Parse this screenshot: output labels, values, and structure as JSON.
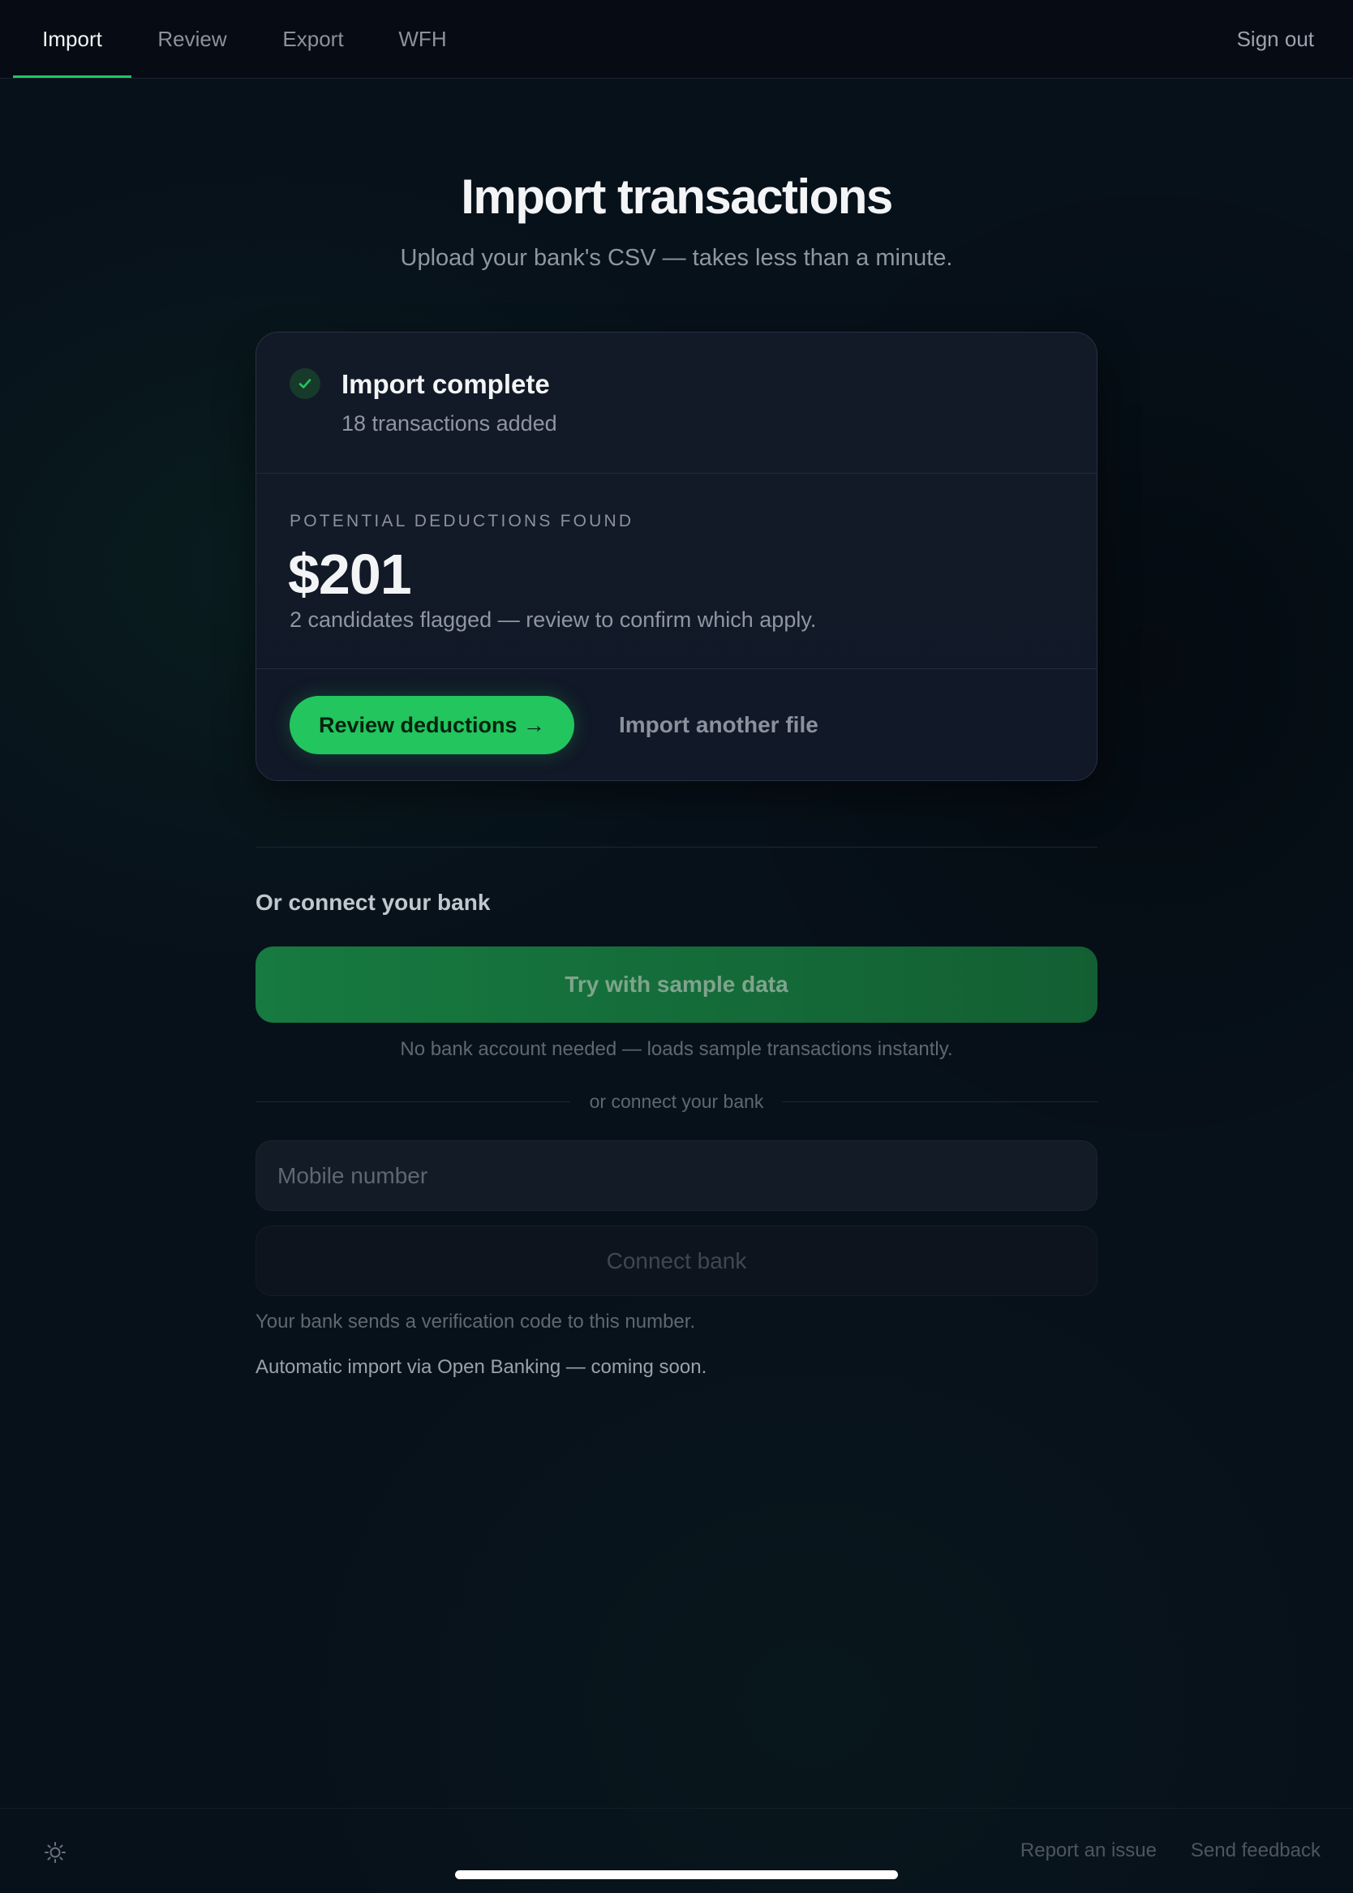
{
  "nav": {
    "tabs": [
      {
        "label": "Import",
        "active": true
      },
      {
        "label": "Review",
        "active": false
      },
      {
        "label": "Export",
        "active": false
      },
      {
        "label": "WFH",
        "active": false
      }
    ],
    "sign_out": "Sign out"
  },
  "header": {
    "title": "Import transactions",
    "subtitle": "Upload your bank's CSV — takes less than a minute."
  },
  "result": {
    "status_icon": "check-icon",
    "title": "Import complete",
    "subtitle": "18 transactions added",
    "deductions_label": "POTENTIAL DEDUCTIONS FOUND",
    "deductions_amount": "$201",
    "deductions_note": "2 candidates flagged — review to confirm which apply.",
    "review_button": "Review deductions →",
    "import_another": "Import another file"
  },
  "connect": {
    "heading": "Or connect your bank",
    "sample_button": "Try with sample data",
    "sample_note": "No bank account needed — loads sample transactions instantly.",
    "divider_text": "or connect your bank",
    "mobile_placeholder": "Mobile number",
    "mobile_value": "",
    "connect_button": "Connect bank",
    "verify_note": "Your bank sends a verification code to this number.",
    "open_banking_note": "Automatic import via Open Banking — coming soon."
  },
  "footer": {
    "theme_icon": "sun-icon",
    "report_issue": "Report an issue",
    "send_feedback": "Send feedback"
  },
  "colors": {
    "accent": "#22c55e",
    "background": "#07111a",
    "card": "#111827"
  }
}
